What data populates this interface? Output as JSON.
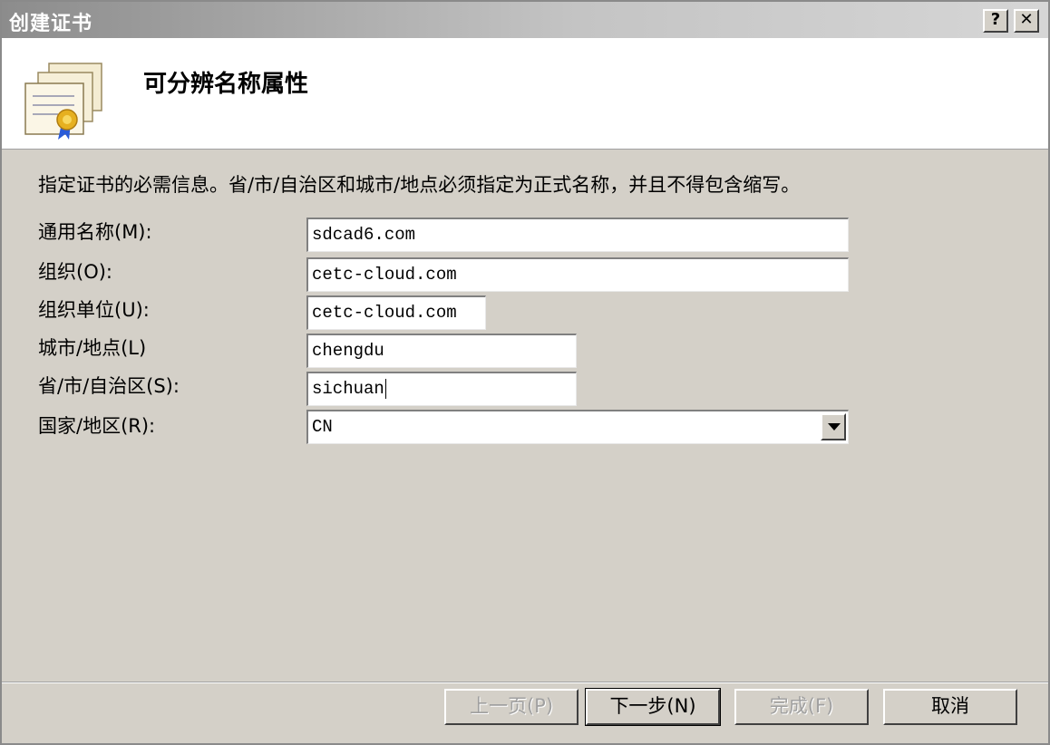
{
  "window": {
    "title": "创建证书",
    "help_label": "?",
    "close_label": "✕"
  },
  "header": {
    "title": "可分辨名称属性",
    "icon": "certificate-icon"
  },
  "instruction": "指定证书的必需信息。省/市/自治区和城市/地点必须指定为正式名称，并且不得包含缩写。",
  "fields": {
    "common_name": {
      "label": "通用名称(M):",
      "value": "sdcad6.com"
    },
    "organization": {
      "label": "组织(O):",
      "value": "cetc-cloud.com"
    },
    "org_unit": {
      "label": "组织单位(U):",
      "value": "cetc-cloud.com"
    },
    "city": {
      "label": "城市/地点(L)",
      "value": "chengdu"
    },
    "state": {
      "label": "省/市/自治区(S):",
      "value": "sichuan"
    },
    "country": {
      "label": "国家/地区(R):",
      "value": "CN"
    }
  },
  "buttons": {
    "back": "上一页(P)",
    "next": "下一步(N)",
    "finish": "完成(F)",
    "cancel": "取消"
  },
  "colors": {
    "dialog_bg": "#d4d0c8",
    "header_bg": "#ffffff",
    "disabled_text": "#a0a0a0"
  }
}
